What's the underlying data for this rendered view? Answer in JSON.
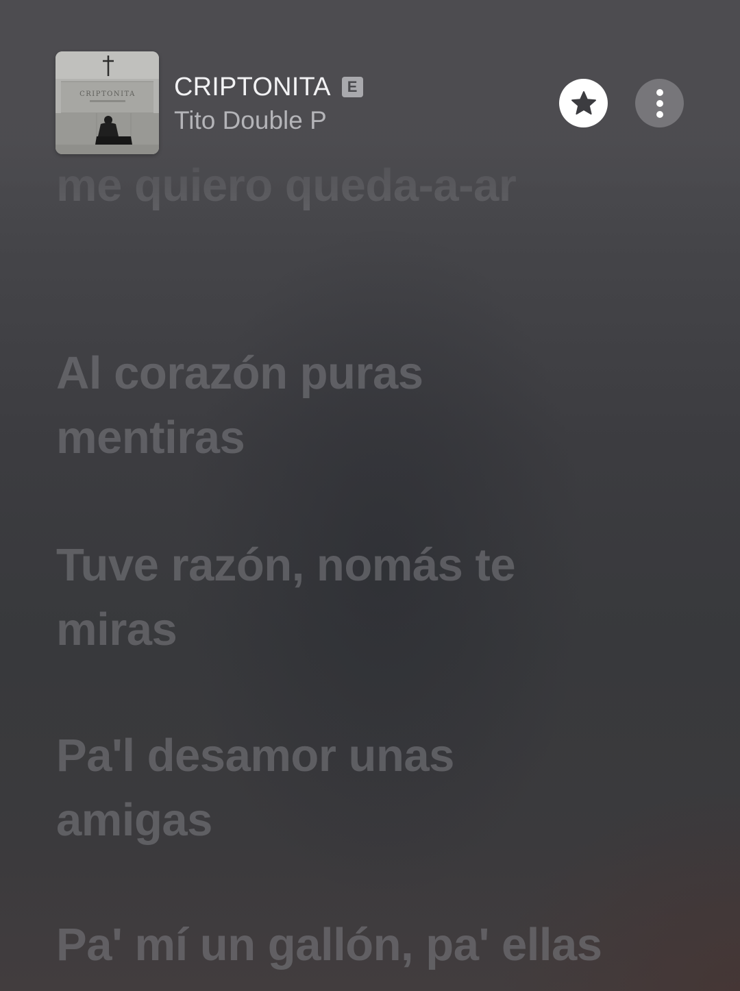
{
  "now_playing": {
    "title": "CRIPTONITA",
    "explicit_badge": "E",
    "artist": "Tito Double P",
    "artwork_caption": "CRIPTONITA",
    "favorite_icon": "star-icon",
    "more_icon": "ellipsis-vertical-icon"
  },
  "lyrics": {
    "lines": [
      "me quiero queda-a-ar",
      "Al corazón puras mentiras",
      "Tuve razón, nomás te miras",
      "Pa'l desamor unas amigas",
      "Pa' mí un gallón, pa' ellas"
    ]
  },
  "colors": {
    "background": "#3c3c40",
    "lyric_dim": "#76767a",
    "title": "#f2f2f4",
    "artist": "#b4b4b8",
    "favorite_button": "#ffffff",
    "more_button": "#77767a"
  }
}
